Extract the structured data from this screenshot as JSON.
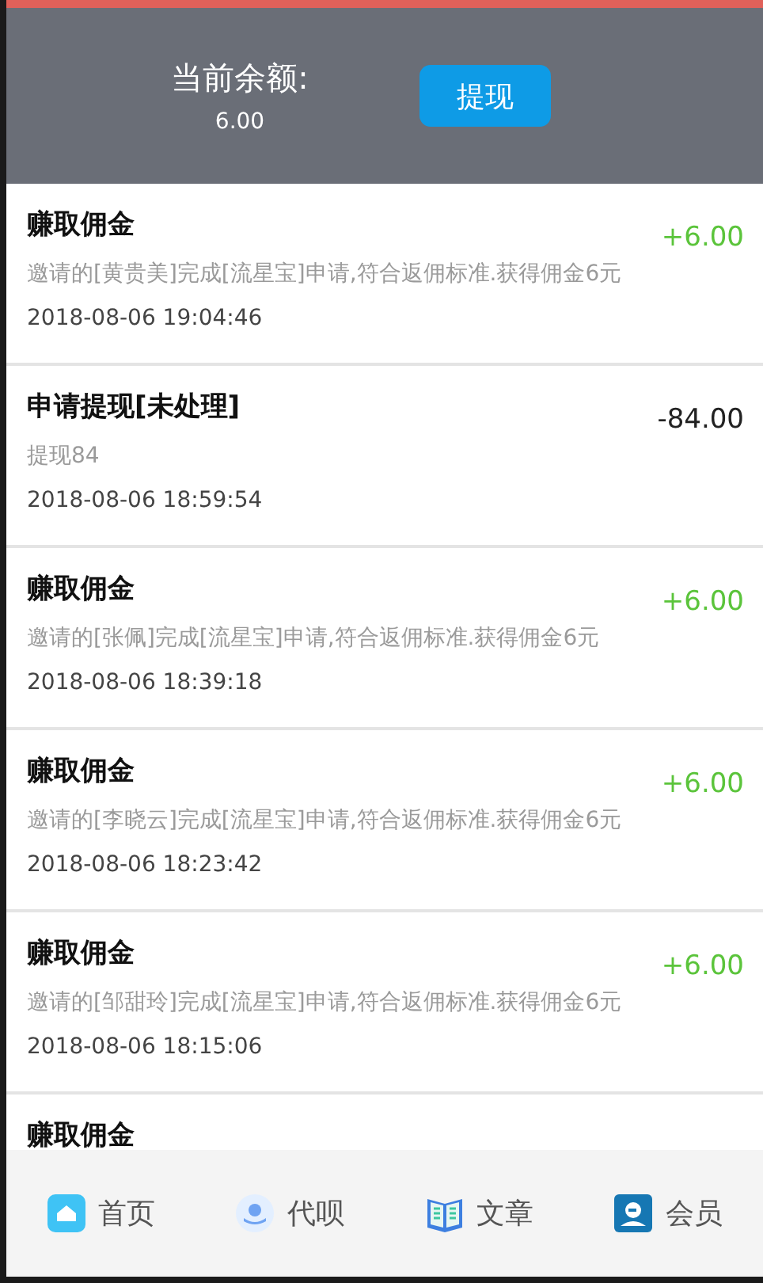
{
  "header": {
    "label": "当前余额:",
    "balance": "6.00",
    "button": "提现"
  },
  "records": [
    {
      "title": "赚取佣金",
      "desc": "邀请的[黄贵美]完成[流星宝]申请,符合返佣标准.获得佣金6元",
      "time": "2018-08-06 19:04:46",
      "amount": "+6.00",
      "kind": "income"
    },
    {
      "title": "申请提现[未处理]",
      "desc": "提现84",
      "time": "2018-08-06 18:59:54",
      "amount": "-84.00",
      "kind": "withdraw"
    },
    {
      "title": "赚取佣金",
      "desc": "邀请的[张佩]完成[流星宝]申请,符合返佣标准.获得佣金6元",
      "time": "2018-08-06 18:39:18",
      "amount": "+6.00",
      "kind": "income"
    },
    {
      "title": "赚取佣金",
      "desc": "邀请的[李晓云]完成[流星宝]申请,符合返佣标准.获得佣金6元",
      "time": "2018-08-06 18:23:42",
      "amount": "+6.00",
      "kind": "income"
    },
    {
      "title": "赚取佣金",
      "desc": "邀请的[邹甜玲]完成[流星宝]申请,符合返佣标准.获得佣金6元",
      "time": "2018-08-06 18:15:06",
      "amount": "+6.00",
      "kind": "income"
    },
    {
      "title": "赚取佣金"
    }
  ],
  "nav": [
    {
      "label": "首页",
      "kind": "home"
    },
    {
      "label": "代呗",
      "kind": "hand"
    },
    {
      "label": "文章",
      "kind": "book"
    },
    {
      "label": "会员",
      "kind": "member"
    }
  ]
}
